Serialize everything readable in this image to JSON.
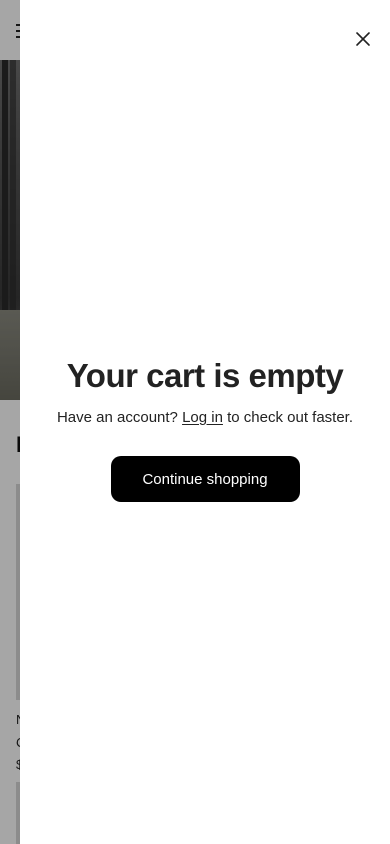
{
  "background_page": {
    "section_title": "F",
    "product_lines": [
      "N",
      "C",
      "$"
    ],
    "menu_icon": "hamburger-menu-icon"
  },
  "cart_drawer": {
    "close_icon": "close-icon",
    "title": "Your cart is empty",
    "account_prompt": "Have an account?",
    "login_link": "Log in",
    "account_suffix": "to check out faster.",
    "continue_label": "Continue shopping"
  },
  "colors": {
    "button_bg": "#000000",
    "button_text": "#ffffff",
    "text": "#222222",
    "drawer_bg": "#ffffff"
  }
}
